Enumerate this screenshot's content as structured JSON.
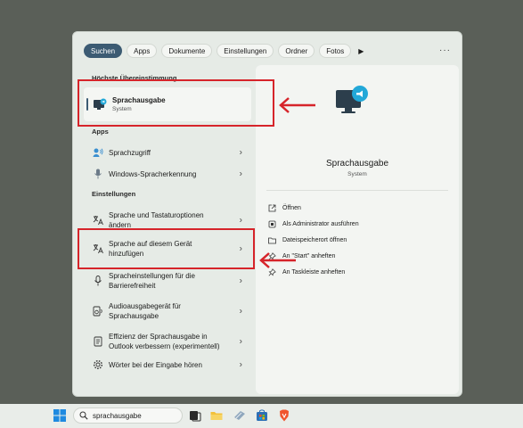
{
  "filters": {
    "active": "Suchen",
    "items": [
      "Apps",
      "Dokumente",
      "Einstellungen",
      "Ordner",
      "Fotos"
    ],
    "play": "▶",
    "more": "···"
  },
  "sections": {
    "best": "Höchste Übereinstimmung",
    "apps": "Apps",
    "settings": "Einstellungen"
  },
  "best_match": {
    "title": "Sprachausgabe",
    "subtitle": "System"
  },
  "apps": [
    {
      "label": "Sprachzugriff"
    },
    {
      "label": "Windows-Spracherkennung"
    }
  ],
  "settings": [
    {
      "line1": "Sprache und Tastaturoptionen",
      "line2": "ändern"
    },
    {
      "line1": "Sprache auf diesem Gerät",
      "line2": "hinzufügen"
    },
    {
      "line1": "Spracheinstellungen für die",
      "line2": "Barrierefreiheit"
    },
    {
      "line1": "Audioausgabegerät für",
      "line2": "Sprachausgabe"
    },
    {
      "line1": "Effizienz der Sprachausgabe in",
      "line2": "Outlook verbessern (experimentell)"
    },
    {
      "line1": "Wörter bei der Eingabe hören",
      "line2": ""
    }
  ],
  "preview": {
    "name": "Sprachausgabe",
    "category": "System",
    "actions": [
      "Öffnen",
      "Als Administrator ausführen",
      "Dateispeicherort öffnen",
      "An \"Start\" anheften",
      "An Taskleiste anheften"
    ]
  },
  "taskbar": {
    "search_text": "sprachausgabe"
  },
  "colors": {
    "accent": "#3c5b73",
    "annotation": "#d6242a",
    "background": "#5a5f58"
  }
}
